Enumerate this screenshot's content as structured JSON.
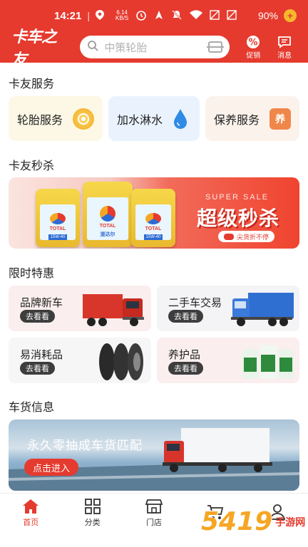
{
  "status": {
    "time": "14:21",
    "net_speed_value": "6.14",
    "net_speed_unit": "KB/S",
    "battery": "90%"
  },
  "header": {
    "logo": "卡车之友",
    "search_placeholder": "中策轮胎",
    "promo_label": "促销",
    "message_label": "消息",
    "accent": "#e53a2e"
  },
  "services": {
    "title": "卡友服务",
    "items": [
      {
        "label": "轮胎服务",
        "icon": "tire-coin-icon"
      },
      {
        "label": "加水淋水",
        "icon": "water-drop-icon"
      },
      {
        "label": "保养服务",
        "icon": "maintenance-badge-icon",
        "badge": "养"
      }
    ]
  },
  "flash": {
    "title": "卡友秒杀",
    "sale_en": "SUPER SALE",
    "sale_title": "超级秒杀",
    "sale_sub": "尖货折不停",
    "bucket_brand": "TOTAL",
    "bucket_cn": "道达尔",
    "bucket_grade": "15W-40"
  },
  "deals": {
    "title": "限时特惠",
    "button": "去看看",
    "items": [
      {
        "label": "品牌新车",
        "art": "red-truck-image"
      },
      {
        "label": "二手车交易",
        "art": "blue-truck-image"
      },
      {
        "label": "易消耗品",
        "art": "tires-image"
      },
      {
        "label": "养护品",
        "art": "antifreeze-bottles-image"
      }
    ]
  },
  "cargo": {
    "title": "车货信息",
    "slogan": "永久零抽成车货匹配",
    "button": "点击进入"
  },
  "tabs": [
    {
      "label": "首页",
      "icon": "home-icon",
      "active": true
    },
    {
      "label": "分类",
      "icon": "grid-icon",
      "active": false
    },
    {
      "label": "门店",
      "icon": "store-icon",
      "active": false
    },
    {
      "label": "",
      "icon": "cart-icon",
      "active": false
    },
    {
      "label": "",
      "icon": "user-icon",
      "active": false
    }
  ],
  "watermark": {
    "number": "5419",
    "text": "手游网"
  }
}
